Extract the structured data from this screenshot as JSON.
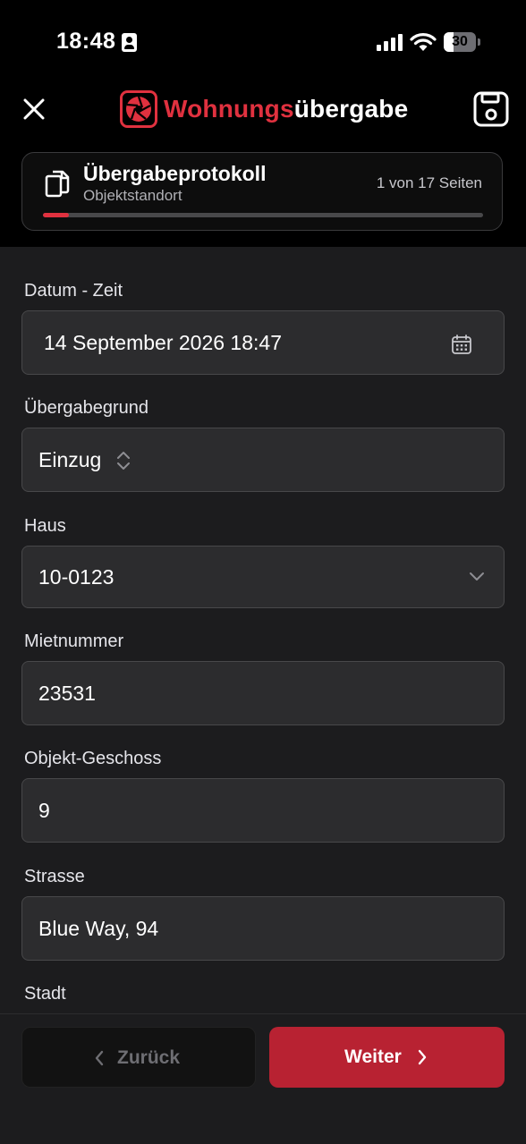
{
  "status_bar": {
    "time": "18:48",
    "battery": "30",
    "battery_fraction": 0.3
  },
  "header": {
    "brand_part1": "Wohnungs",
    "brand_part2": "übergabe"
  },
  "progress_card": {
    "title": "Übergabeprotokoll",
    "subtitle": "Objektstandort",
    "pages": "1 von 17 Seiten",
    "progress_fraction": 0.0588
  },
  "form": {
    "datetime_label": "Datum - Zeit",
    "datetime_value": "14 September 2026 18:47",
    "reason_label": "Übergabegrund",
    "reason_value": "Einzug",
    "house_label": "Haus",
    "house_value": "10-0123",
    "rent_number_label": "Mietnummer",
    "rent_number_value": "23531",
    "floor_label": "Objekt-Geschoss",
    "floor_value": "9",
    "street_label": "Strasse",
    "street_value": "Blue Way, 94",
    "city_label": "Stadt"
  },
  "footer": {
    "back_label": "Zurück",
    "next_label": "Weiter"
  },
  "colors": {
    "accent": "#e0313f",
    "next_button": "#b82232",
    "field_bg": "#2c2c2e",
    "page_bg": "#1c1c1e"
  },
  "icons": [
    "close-icon",
    "app-logo-icon",
    "save-icon",
    "documents-icon",
    "calendar-icon",
    "up-down-chevron-icon",
    "chevron-down-icon",
    "chevron-left-icon",
    "chevron-right-icon"
  ]
}
